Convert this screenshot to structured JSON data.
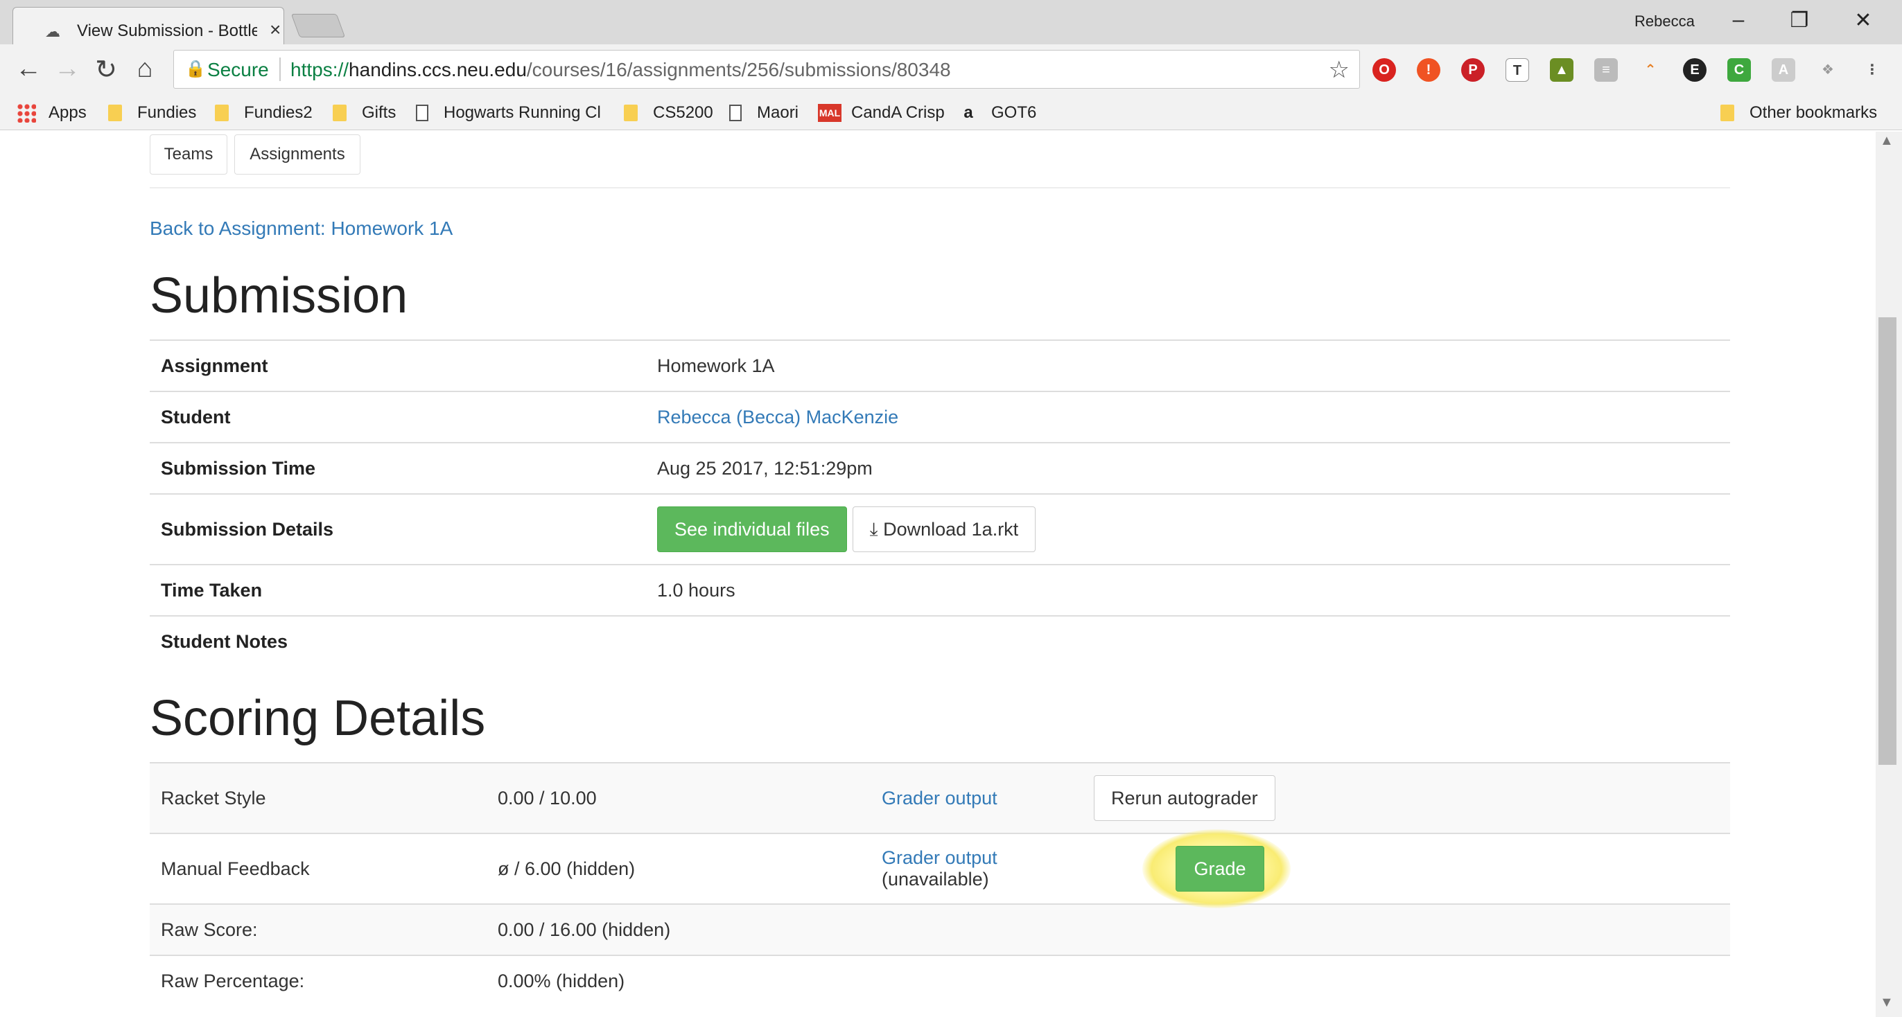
{
  "browser": {
    "tab_title": "View Submission - Bottle",
    "profile_name": "Rebecca",
    "secure_label": "Secure",
    "url_scheme": "https://",
    "url_host": "handins.ccs.neu.edu",
    "url_path": "/courses/16/assignments/256/submissions/80348",
    "bookmarks": [
      "Apps",
      "Fundies",
      "Fundies2",
      "Gifts",
      "Hogwarts Running Cl",
      "CS5200",
      "Maori",
      "CandA Crisp",
      "GOT6"
    ],
    "other_bookmarks": "Other bookmarks"
  },
  "nav": {
    "teams": "Teams",
    "assignments": "Assignments"
  },
  "back_link": "Back to Assignment: Homework 1A",
  "submission": {
    "heading": "Submission",
    "rows": [
      {
        "key": "Assignment",
        "value": "Homework 1A"
      },
      {
        "key": "Student",
        "value": "Rebecca (Becca) MacKenzie"
      },
      {
        "key": "Submission Time",
        "value": "Aug 25 2017, 12:51:29pm"
      },
      {
        "key": "Submission Details",
        "value": ""
      },
      {
        "key": "Time Taken",
        "value": "1.0 hours"
      },
      {
        "key": "Student Notes",
        "value": ""
      }
    ],
    "see_files_label": "See individual files",
    "download_label": "Download 1a.rkt"
  },
  "scoring": {
    "heading": "Scoring Details",
    "rows": [
      {
        "name": "Racket Style",
        "score": "0.00 / 10.00",
        "link": "Grader output",
        "link_suffix": "",
        "action": "Rerun autograder"
      },
      {
        "name": "Manual Feedback",
        "score": "ø / 6.00 (hidden)",
        "link": "Grader output",
        "link_suffix": " (unavailable)",
        "action": "Grade"
      },
      {
        "name": "Raw Score:",
        "score": "0.00 / 16.00 (hidden)"
      },
      {
        "name": "Raw Percentage:",
        "score": "0.00% (hidden)"
      }
    ]
  }
}
